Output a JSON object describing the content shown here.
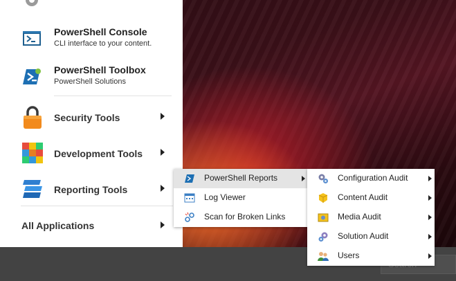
{
  "start_menu": {
    "top_items": [
      {
        "title": "PowerShell Console",
        "subtitle": "CLI interface to your content."
      },
      {
        "title": "PowerShell Toolbox",
        "subtitle": "PowerShell Solutions"
      }
    ],
    "categories": [
      {
        "label": "Security Tools"
      },
      {
        "label": "Development Tools"
      },
      {
        "label": "Reporting Tools"
      }
    ],
    "all_applications": "All Applications"
  },
  "reporting_submenu": {
    "items": [
      {
        "label": "PowerShell Reports"
      },
      {
        "label": "Log Viewer"
      },
      {
        "label": "Scan for Broken Links"
      }
    ]
  },
  "reports_submenu": {
    "items": [
      {
        "label": "Configuration Audit"
      },
      {
        "label": "Content Audit"
      },
      {
        "label": "Media Audit"
      },
      {
        "label": "Solution Audit"
      },
      {
        "label": "Users"
      }
    ]
  },
  "taskbar": {
    "search_placeholder": "Search"
  }
}
